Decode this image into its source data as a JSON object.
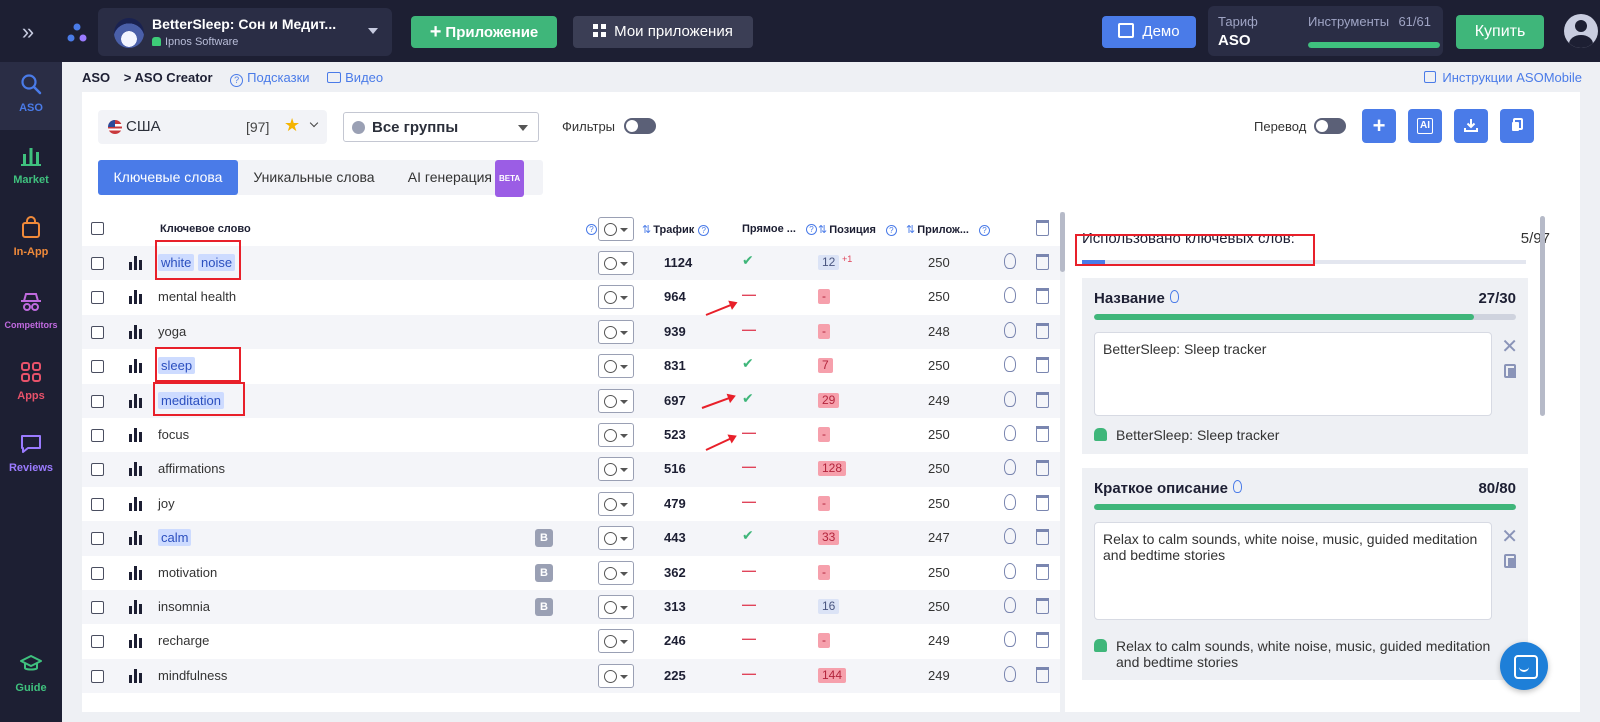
{
  "topbar": {
    "app_name": "BetterSleep: Сон и Медит...",
    "app_developer": "Ipnos Software",
    "add_app_label": "Приложение",
    "my_apps_label": "Мои приложения",
    "demo_label": "Демо",
    "tariff_label": "Тариф",
    "tariff_value": "ASO",
    "tools_label": "Инструменты",
    "tools_count": "61/61",
    "tools_progress": 1.0,
    "buy_label": "Купить"
  },
  "sidebar": {
    "items": [
      {
        "label": "ASO",
        "icon": "search-icon",
        "color": "#4a7be8"
      },
      {
        "label": "Market",
        "icon": "bar-chart-icon",
        "color": "#3fc17e"
      },
      {
        "label": "In-App",
        "icon": "shopping-bag-icon",
        "color": "#f08a3a"
      },
      {
        "label": "Competitors",
        "icon": "spy-icon",
        "color": "#c06adf"
      },
      {
        "label": "Apps",
        "icon": "apps-grid-icon",
        "color": "#e8526a"
      },
      {
        "label": "Reviews",
        "icon": "chat-icon",
        "color": "#9b7bff"
      },
      {
        "label": "Guide",
        "icon": "graduation-cap-icon",
        "color": "#3fc17e"
      }
    ]
  },
  "breadcrumb": {
    "root": "ASO",
    "current": "> ASO Creator",
    "hints": "Подсказки",
    "video": "Видео",
    "instructions": "Инструкции ASOMobile"
  },
  "toolbar": {
    "country": "США",
    "country_count": "[97]",
    "groups": "Все группы",
    "filters_label": "Фильтры",
    "translate_label": "Перевод",
    "ai_label": "AI"
  },
  "tabs": [
    {
      "label": "Ключевые слова",
      "active": true
    },
    {
      "label": "Уникальные слова",
      "active": false
    },
    {
      "label": "AI генерация",
      "active": false,
      "badge": "BETA"
    }
  ],
  "table": {
    "headers": {
      "keyword": "Ключевое слово",
      "traffic": "Трафик",
      "direct": "Прямое ...",
      "position": "Позиция",
      "apps": "Прилож..."
    },
    "rows": [
      {
        "keyword": [
          "white",
          "noise"
        ],
        "highlight": true,
        "badge": "",
        "traffic": "1124",
        "direct": true,
        "position": "12",
        "position_style": "blue",
        "delta": "+1",
        "apps": "250"
      },
      {
        "keyword": [
          "mental health"
        ],
        "highlight": false,
        "badge": "",
        "traffic": "964",
        "direct": false,
        "position": "-",
        "position_style": "red",
        "delta": "",
        "apps": "250"
      },
      {
        "keyword": [
          "yoga"
        ],
        "highlight": false,
        "badge": "",
        "traffic": "939",
        "direct": false,
        "position": "-",
        "position_style": "red",
        "delta": "",
        "apps": "248"
      },
      {
        "keyword": [
          "sleep"
        ],
        "highlight": true,
        "badge": "",
        "traffic": "831",
        "direct": true,
        "position": "7",
        "position_style": "red",
        "delta": "",
        "apps": "250"
      },
      {
        "keyword": [
          "meditation"
        ],
        "highlight": true,
        "badge": "",
        "traffic": "697",
        "direct": true,
        "position": "29",
        "position_style": "red",
        "delta": "",
        "apps": "249"
      },
      {
        "keyword": [
          "focus"
        ],
        "highlight": false,
        "badge": "",
        "traffic": "523",
        "direct": false,
        "position": "-",
        "position_style": "red",
        "delta": "",
        "apps": "250"
      },
      {
        "keyword": [
          "affirmations"
        ],
        "highlight": false,
        "badge": "",
        "traffic": "516",
        "direct": false,
        "position": "128",
        "position_style": "red",
        "delta": "",
        "apps": "250"
      },
      {
        "keyword": [
          "joy"
        ],
        "highlight": false,
        "badge": "",
        "traffic": "479",
        "direct": false,
        "position": "-",
        "position_style": "red",
        "delta": "",
        "apps": "250"
      },
      {
        "keyword": [
          "calm"
        ],
        "highlight": true,
        "badge": "B",
        "traffic": "443",
        "direct": true,
        "position": "33",
        "position_style": "red",
        "delta": "",
        "apps": "247"
      },
      {
        "keyword": [
          "motivation"
        ],
        "highlight": false,
        "badge": "B",
        "traffic": "362",
        "direct": false,
        "position": "-",
        "position_style": "red",
        "delta": "",
        "apps": "250"
      },
      {
        "keyword": [
          "insomnia"
        ],
        "highlight": false,
        "badge": "B",
        "traffic": "313",
        "direct": false,
        "position": "16",
        "position_style": "blue",
        "delta": "",
        "apps": "250"
      },
      {
        "keyword": [
          "recharge"
        ],
        "highlight": false,
        "badge": "",
        "traffic": "246",
        "direct": false,
        "position": "-",
        "position_style": "red",
        "delta": "",
        "apps": "249"
      },
      {
        "keyword": [
          "mindfulness"
        ],
        "highlight": false,
        "badge": "",
        "traffic": "225",
        "direct": false,
        "position": "144",
        "position_style": "red",
        "delta": "",
        "apps": "249"
      }
    ]
  },
  "right_panel": {
    "used_label": "Использовано ключевых слов:",
    "used_count": "5/97",
    "used_progress": 0.052,
    "cards": [
      {
        "title": "Название",
        "count": "27/30",
        "progress": 0.9,
        "text": "BetterSleep: Sleep tracker",
        "preview": "BetterSleep: Sleep tracker"
      },
      {
        "title": "Краткое описание",
        "count": "80/80",
        "progress": 1.0,
        "text": "Relax to calm sounds, white noise, music, guided meditation and bedtime stories",
        "preview": "Relax to calm sounds, white noise, music, guided meditation and bedtime stories"
      }
    ]
  },
  "colors": {
    "accent": "#4a7be8",
    "green": "#3fb67a",
    "red_annotation": "#e8202a",
    "dark": "#1d1f33"
  }
}
